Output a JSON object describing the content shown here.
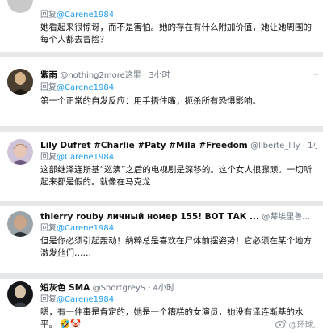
{
  "tweets": [
    {
      "reply_prefix": "回复",
      "reply_to": "@Carene1984",
      "text": "她看起来很惊讶，而不是害怕。她的存在有什么附加价值，她让她周围的每个人都去冒险？"
    },
    {
      "name": "紫雨",
      "handle": "@nothing2more这里 · 3小时",
      "reply_prefix": "回复",
      "reply_to": "@Carene1984",
      "text": "第一个正常的自发反应：用手捂住嘴，扼杀所有恐惧影响。"
    },
    {
      "name": "Lily Dufret #Charlie #Paty #Mila #Freedom",
      "handle": "@liberte_lily · 1小时",
      "reply_prefix": "回复",
      "reply_to": "@Carene1984",
      "text": "这部继泽连斯基“巡演”之后的电视剧是深移的。这个女人很骤顽。一切听起来都是假的。就像在马克龙"
    },
    {
      "name": "thierry rouby личный номер 155! ВОТ ТАК ...",
      "handle": "@蒂埃里鲁...",
      "reply_prefix": "回复",
      "reply_to": "@Carene1984",
      "text": "但是你必须引起轰动！纳粹总是喜欢在尸体前摆姿势！它必须在某个地方激发他们……"
    },
    {
      "name": "短灰色 SMA",
      "handle": "@ShortgreyS · 4小时",
      "reply_prefix": "回复",
      "reply_to": "@Carene1984",
      "text": "嗯，有一件事是肯定的，她是一个糟糕的女演员，她没有泽连斯基的水平。",
      "emojis": "🤣🤡"
    }
  ],
  "watermark": "@环球..",
  "icons": {
    "more": "more-options-icon"
  }
}
